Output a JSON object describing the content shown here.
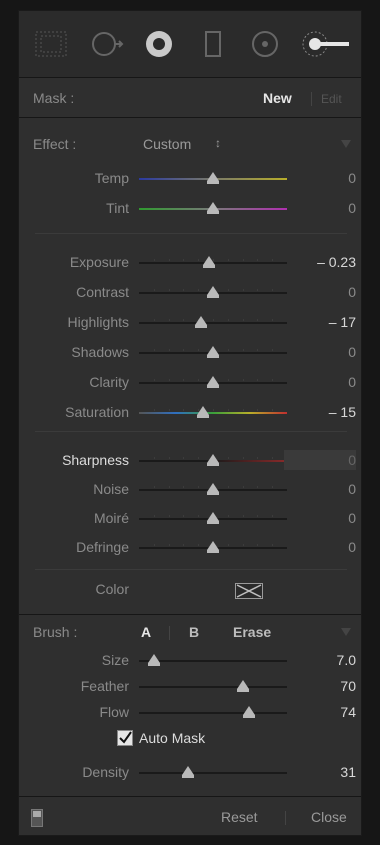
{
  "mask": {
    "label": "Mask :",
    "new": "New",
    "edit": "Edit"
  },
  "effect": {
    "label": "Effect :",
    "preset": "Custom",
    "preset_arrow": "↕"
  },
  "wb": [
    {
      "label": "Temp",
      "value": "0",
      "position": 0.5
    },
    {
      "label": "Tint",
      "value": "0",
      "position": 0.5
    }
  ],
  "tone": [
    {
      "label": "Exposure",
      "value": "– 0.23",
      "position": 0.47
    },
    {
      "label": "Contrast",
      "value": "0",
      "position": 0.5
    },
    {
      "label": "Highlights",
      "value": "– 17",
      "position": 0.42
    },
    {
      "label": "Shadows",
      "value": "0",
      "position": 0.5
    },
    {
      "label": "Clarity",
      "value": "0",
      "position": 0.5
    },
    {
      "label": "Saturation",
      "value": "– 15",
      "position": 0.43
    }
  ],
  "detail": [
    {
      "label": "Sharpness",
      "value": "0",
      "position": 0.5
    },
    {
      "label": "Noise",
      "value": "0",
      "position": 0.5
    },
    {
      "label": "Moiré",
      "value": "0",
      "position": 0.5
    },
    {
      "label": "Defringe",
      "value": "0",
      "position": 0.5
    }
  ],
  "color": {
    "label": "Color"
  },
  "brush": {
    "label": "Brush :",
    "a": "A",
    "b": "B",
    "erase": "Erase",
    "size": {
      "label": "Size",
      "value": "7.0",
      "position": 0.1
    },
    "feather": {
      "label": "Feather",
      "value": "70",
      "position": 0.7
    },
    "flow": {
      "label": "Flow",
      "value": "74",
      "position": 0.74
    },
    "automask": {
      "label": "Auto Mask",
      "checked": true
    },
    "density": {
      "label": "Density",
      "value": "31",
      "position": 0.33
    }
  },
  "footer": {
    "reset": "Reset",
    "close": "Close"
  },
  "colors": {
    "accent": "#d8d8d8",
    "panel": "#2f2f2f"
  }
}
